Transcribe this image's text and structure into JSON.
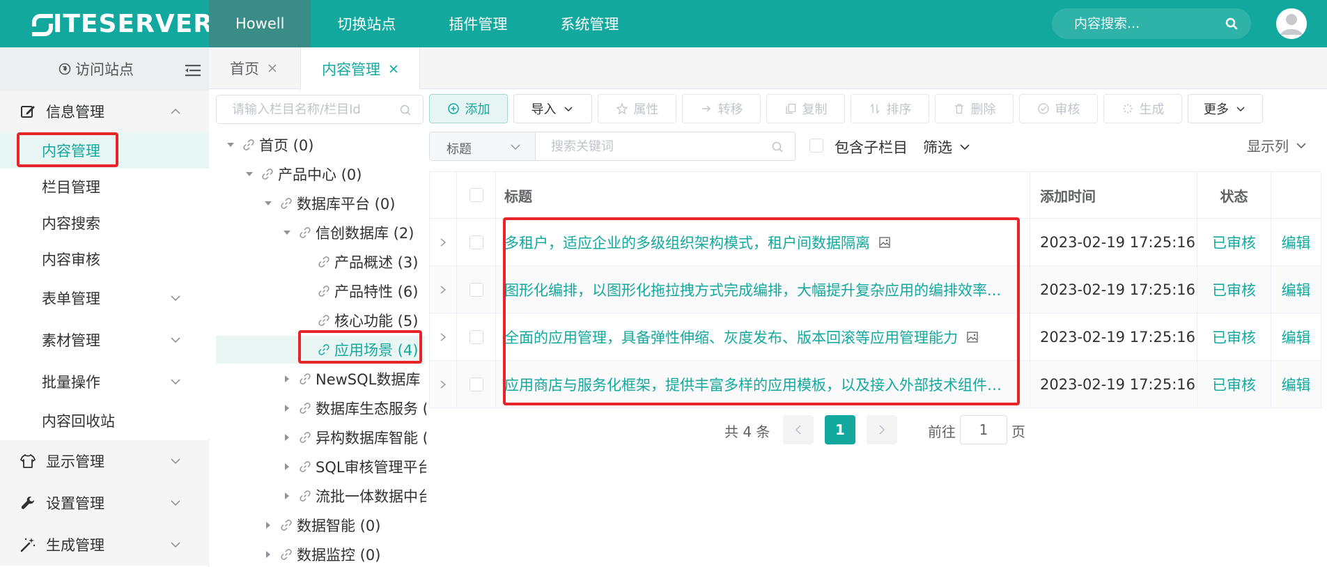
{
  "app": {
    "logo_text": "ITESERVER",
    "brand_color": "#13a89e"
  },
  "topnav": [
    "Howell",
    "切换站点",
    "插件管理",
    "系统管理"
  ],
  "top_search": {
    "placeholder": "内容搜索..."
  },
  "sidebar": {
    "visit_label": "访问站点",
    "groups": [
      {
        "label": "信息管理",
        "icon": "edit-icon",
        "expanded": true,
        "items": [
          "内容管理",
          "栏目管理",
          "内容搜索",
          "内容审核",
          "表单管理",
          "素材管理",
          "批量操作",
          "内容回收站"
        ]
      },
      {
        "label": "显示管理",
        "icon": "shirt-icon"
      },
      {
        "label": "设置管理",
        "icon": "wrench-icon"
      },
      {
        "label": "生成管理",
        "icon": "magic-wand-icon"
      }
    ],
    "active_item": "内容管理"
  },
  "tabs": [
    {
      "label": "首页",
      "active": false
    },
    {
      "label": "内容管理",
      "active": true
    }
  ],
  "tree": {
    "search_placeholder": "请输入栏目名称/栏目Id",
    "nodes": [
      {
        "label": "首页 (0)",
        "level": 0,
        "caret": "down"
      },
      {
        "label": "产品中心 (0)",
        "level": 1,
        "caret": "down"
      },
      {
        "label": "数据库平台 (0)",
        "level": 2,
        "caret": "down"
      },
      {
        "label": "信创数据库 (2)",
        "level": 3,
        "caret": "down"
      },
      {
        "label": "产品概述 (3)",
        "level": 4,
        "caret": "none"
      },
      {
        "label": "产品特性 (6)",
        "level": 4,
        "caret": "none"
      },
      {
        "label": "核心功能 (5)",
        "level": 4,
        "caret": "none"
      },
      {
        "label": "应用场景 (4)",
        "level": 4,
        "caret": "none",
        "selected": true
      },
      {
        "label": "NewSQL数据库",
        "level": 3,
        "caret": "right"
      },
      {
        "label": "数据库生态服务 (",
        "level": 3,
        "caret": "right"
      },
      {
        "label": "异构数据库智能 (",
        "level": 3,
        "caret": "right"
      },
      {
        "label": "SQL审核管理平台",
        "level": 3,
        "caret": "right"
      },
      {
        "label": "流批一体数据中台",
        "level": 3,
        "caret": "right"
      },
      {
        "label": "数据智能 (0)",
        "level": 2,
        "caret": "right"
      },
      {
        "label": "数据监控 (0)",
        "level": 2,
        "caret": "right"
      }
    ]
  },
  "toolbar": {
    "buttons": [
      {
        "label": "添加",
        "icon": "plus-circle-icon",
        "state": "primary"
      },
      {
        "label": "导入",
        "icon": "chevron-down-icon",
        "state": "normal"
      },
      {
        "label": "属性",
        "icon": "star-icon",
        "state": "disabled"
      },
      {
        "label": "转移",
        "icon": "arrow-right-icon",
        "state": "disabled"
      },
      {
        "label": "复制",
        "icon": "copy-icon",
        "state": "disabled"
      },
      {
        "label": "排序",
        "icon": "sort-icon",
        "state": "disabled"
      },
      {
        "label": "删除",
        "icon": "trash-icon",
        "state": "disabled"
      },
      {
        "label": "审核",
        "icon": "check-circle-icon",
        "state": "disabled"
      },
      {
        "label": "生成",
        "icon": "loading-icon",
        "state": "disabled"
      },
      {
        "label": "更多",
        "icon": "chevron-down-icon",
        "state": "normal"
      }
    ]
  },
  "filter": {
    "field": "标题",
    "keyword_placeholder": "搜索关键词",
    "include_children_label": "包含子栏目",
    "filter_label": "筛选",
    "columns_label": "显示列"
  },
  "table": {
    "headers": {
      "title": "标题",
      "time": "添加时间",
      "status": "状态"
    },
    "rows": [
      {
        "title": "多租户，适应企业的多级组织架构模式，租户间数据隔离",
        "has_image": true,
        "time": "2023-02-19 17:25:16",
        "status": "已审核",
        "action": "编辑"
      },
      {
        "title": "图形化编排，以图形化拖拉拽方式完成编排，大幅提升复杂应用的编排效率...",
        "has_image": false,
        "time": "2023-02-19 17:25:16",
        "status": "已审核",
        "action": "编辑"
      },
      {
        "title": "全面的应用管理，具备弹性伸缩、灰度发布、版本回滚等应用管理能力",
        "has_image": true,
        "time": "2023-02-19 17:25:16",
        "status": "已审核",
        "action": "编辑"
      },
      {
        "title": "应用商店与服务化框架，提供丰富多样的应用模板，以及接入外部技术组件服务",
        "has_image": false,
        "time": "2023-02-19 17:25:16",
        "status": "已审核",
        "action": "编辑"
      }
    ]
  },
  "pagination": {
    "total_text": "共 4 条",
    "current_page": "1",
    "goto_label": "前往",
    "goto_value": "1",
    "goto_unit": "页"
  }
}
